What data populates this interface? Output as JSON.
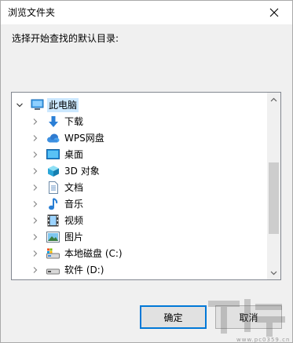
{
  "window": {
    "title": "浏览文件夹",
    "close_glyph": "✕"
  },
  "prompt": "选择开始查找的默认目录:",
  "tree": {
    "items": [
      {
        "label": "此电脑",
        "icon": "computer-icon",
        "expanded": true,
        "selected": true
      },
      {
        "label": "下载",
        "icon": "download-icon"
      },
      {
        "label": "WPS网盘",
        "icon": "cloud-icon"
      },
      {
        "label": "桌面",
        "icon": "desktop-icon"
      },
      {
        "label": "3D 对象",
        "icon": "3d-objects-icon"
      },
      {
        "label": "文档",
        "icon": "document-icon"
      },
      {
        "label": "音乐",
        "icon": "music-icon"
      },
      {
        "label": "视频",
        "icon": "video-icon"
      },
      {
        "label": "图片",
        "icon": "picture-icon"
      },
      {
        "label": "本地磁盘 (C:)",
        "icon": "local-disk-icon"
      },
      {
        "label": "软件 (D:)",
        "icon": "drive-icon"
      }
    ]
  },
  "buttons": {
    "ok": "确定",
    "cancel": "取消"
  },
  "watermark": {
    "site": "www.pc0359.cn"
  },
  "colors": {
    "accent": "#0078d7",
    "selection": "#cce8ff",
    "dialog_bg": "#f0f0f0"
  }
}
